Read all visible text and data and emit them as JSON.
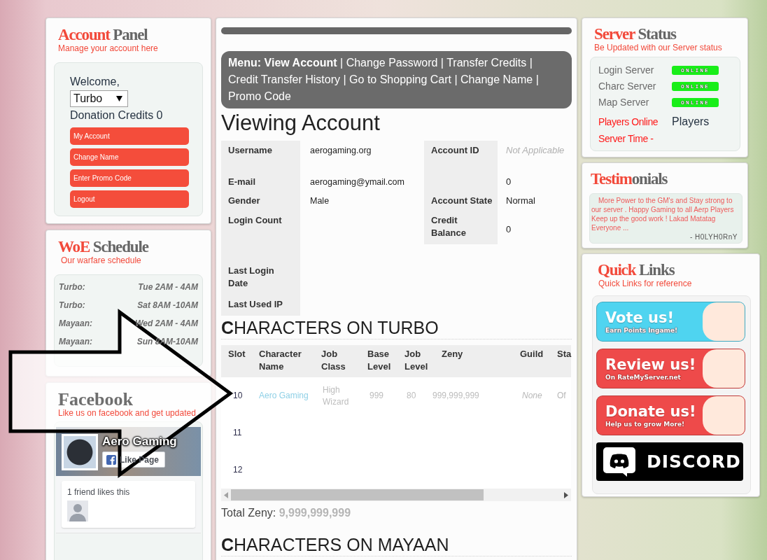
{
  "account_panel": {
    "title_parts": [
      "Account ",
      "Panel"
    ],
    "subtitle": "Manage your account here",
    "welcome": "Welcome,",
    "server_select": {
      "value": "Turbo"
    },
    "credits": "Donation Credits 0",
    "buttons": [
      "My Account",
      "Change Name",
      "Enter Promo Code",
      "Logout"
    ]
  },
  "woe_schedule": {
    "title_parts": [
      "WoE ",
      "Schedule"
    ],
    "subtitle": "Our warfare schedule",
    "entries": [
      {
        "server": "Turbo:",
        "time": "Tue 2AM - 4AM"
      },
      {
        "server": "Turbo:",
        "time": "Sat 8AM -10AM"
      },
      {
        "server": "Mayaan:",
        "time": "Wed 2AM - 4AM"
      },
      {
        "server": "Mayaan:",
        "time": "Sun 8AM-10AM"
      }
    ]
  },
  "facebook": {
    "title_parts": [
      "Facebook"
    ],
    "subtitle": "Like us on facebook and get updated",
    "page_name": "Aero Gaming",
    "like_button": "Like Page",
    "friends_text": "1 friend likes this"
  },
  "account_menu": {
    "label": "Menu:",
    "separator": "|",
    "items": [
      {
        "label": "View Account",
        "selected": true
      },
      {
        "label": "Change Password",
        "selected": false
      },
      {
        "label": "Transfer Credits",
        "selected": false
      },
      {
        "label": "Credit Transfer History",
        "selected": false
      },
      {
        "label": "Go to Shopping Cart",
        "selected": false
      },
      {
        "label": "Change Name",
        "selected": false
      },
      {
        "label": "Promo Code",
        "selected": false
      }
    ]
  },
  "heading": "Viewing Account",
  "account_details": [
    {
      "label": "Username",
      "value": "aerogaming.org",
      "side": {
        "label": "Account ID",
        "value": "Not Applicable",
        "available": false
      }
    },
    {
      "label": "E-mail",
      "value": "aerogaming@ymail.com",
      "side": {
        "value": "0",
        "available": true
      }
    },
    {
      "label": "Gender",
      "value": "Male",
      "side": {
        "label": "Account State",
        "value": "Normal",
        "available": true
      }
    },
    {
      "label": "Login Count",
      "side": {
        "label": "Credit Balance",
        "value": "0",
        "available": true
      }
    },
    {
      "label": "Last Login Date"
    },
    {
      "label": "Last Used IP"
    }
  ],
  "character_tables": [
    {
      "heading": "**C**HARACTERS ON TURBO",
      "columns": [
        "Slot",
        "Character Name",
        "Job Class",
        "Base Level",
        "Job Level",
        "Zeny",
        "Guild",
        "Sta"
      ],
      "rows": [
        {
          "slot": "10",
          "character_name": "Aero Gaming",
          "job_class": "High Wizard",
          "base_level": "999",
          "job_level": "80",
          "zeny": "999,999,999",
          "guild": "None",
          "column_8": "Of"
        },
        {
          "slot": "11"
        },
        {
          "slot": "12"
        }
      ],
      "total_label": "Total Zeny:",
      "total_value": "9,999,999,999"
    },
    {
      "heading": "**C**HARACTERS ON MAYAAN"
    }
  ],
  "server_status": {
    "title_parts": [
      "Server ",
      "Status"
    ],
    "subtitle": "Be Updated with our Server status",
    "servers": [
      {
        "name": "Login Server",
        "status": "ONLINE"
      },
      {
        "name": "Charc Server",
        "status": "ONLINE"
      },
      {
        "name": "Map Server",
        "status": "ONLINE"
      }
    ],
    "players_label": "Players Online",
    "players_value": "Players",
    "time_label": "Server Time -"
  },
  "testimonials": {
    "title_parts": [
      "Testim",
      "onials"
    ],
    "quote": "More Power to the GM's and Stay strong to our server . Happy Gaming to all Aerp Players Keep up the good work ! Lakad Matatag Everyone ...",
    "author": "- H0LYH0RnY"
  },
  "quick_links": {
    "title_parts": [
      "Quick ",
      "Links"
    ],
    "subtitle": "Quick Links for reference",
    "items": [
      {
        "kind": "banner",
        "title": "Vote us!",
        "subtitle": "Earn Points Ingame!",
        "color": "#4fd4f0"
      },
      {
        "kind": "banner",
        "title": "Review us!",
        "subtitle": "On RateMyServer.net",
        "color": "#ee4a4a"
      },
      {
        "kind": "banner",
        "title": "Donate us!",
        "subtitle": "Help us to grow More!",
        "color": "#ee4a4a"
      },
      {
        "kind": "logo",
        "title": "DISCORD",
        "color": "#000000"
      }
    ]
  }
}
